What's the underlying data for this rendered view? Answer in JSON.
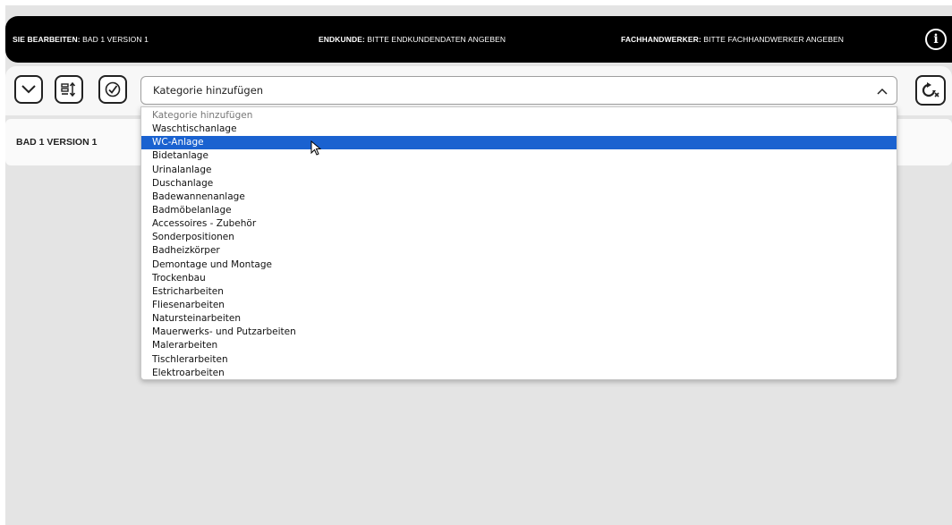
{
  "header": {
    "edit_label": "SIE BEARBEITEN:",
    "edit_value": "BAD 1 VERSION 1",
    "customer_label": "ENDKUNDE:",
    "customer_value": "BITTE ENDKUNDENDATEN ANGEBEN",
    "craftsman_label": "FACHHANDWERKER:",
    "craftsman_value": "BITTE FACHHANDWERKER ANGEBEN",
    "info_icon": "i"
  },
  "toolbar": {
    "collapse_icon": "chevron-down-icon",
    "sort_icon": "sort-list-icon",
    "check_icon": "check-circle-icon",
    "refresh_icon": "refresh-icon",
    "select_value": "Kategorie hinzufügen",
    "select_chevron": "^"
  },
  "panel": {
    "title": "BAD 1 VERSION 1"
  },
  "dropdown": {
    "options": [
      "Kategorie hinzufügen",
      "Waschtischanlage",
      "WC-Anlage",
      "Bidetanlage",
      "Urinalanlage",
      "Duschanlage",
      "Badewannenanlage",
      "Badmöbelanlage",
      "Accessoires - Zubehör",
      "Sonderpositionen",
      "Badheizkörper",
      "Demontage und Montage",
      "Trockenbau",
      "Estricharbeiten",
      "Fliesenarbeiten",
      "Natursteinarbeiten",
      "Mauerwerks- und Putzarbeiten",
      "Malerarbeiten",
      "Tischlerarbeiten",
      "Elektroarbeiten"
    ],
    "highlighted": "WC-Anlage"
  },
  "colors": {
    "header_bg": "#000000",
    "highlight": "#1a62d0",
    "app_bg": "#e4e4e4"
  }
}
